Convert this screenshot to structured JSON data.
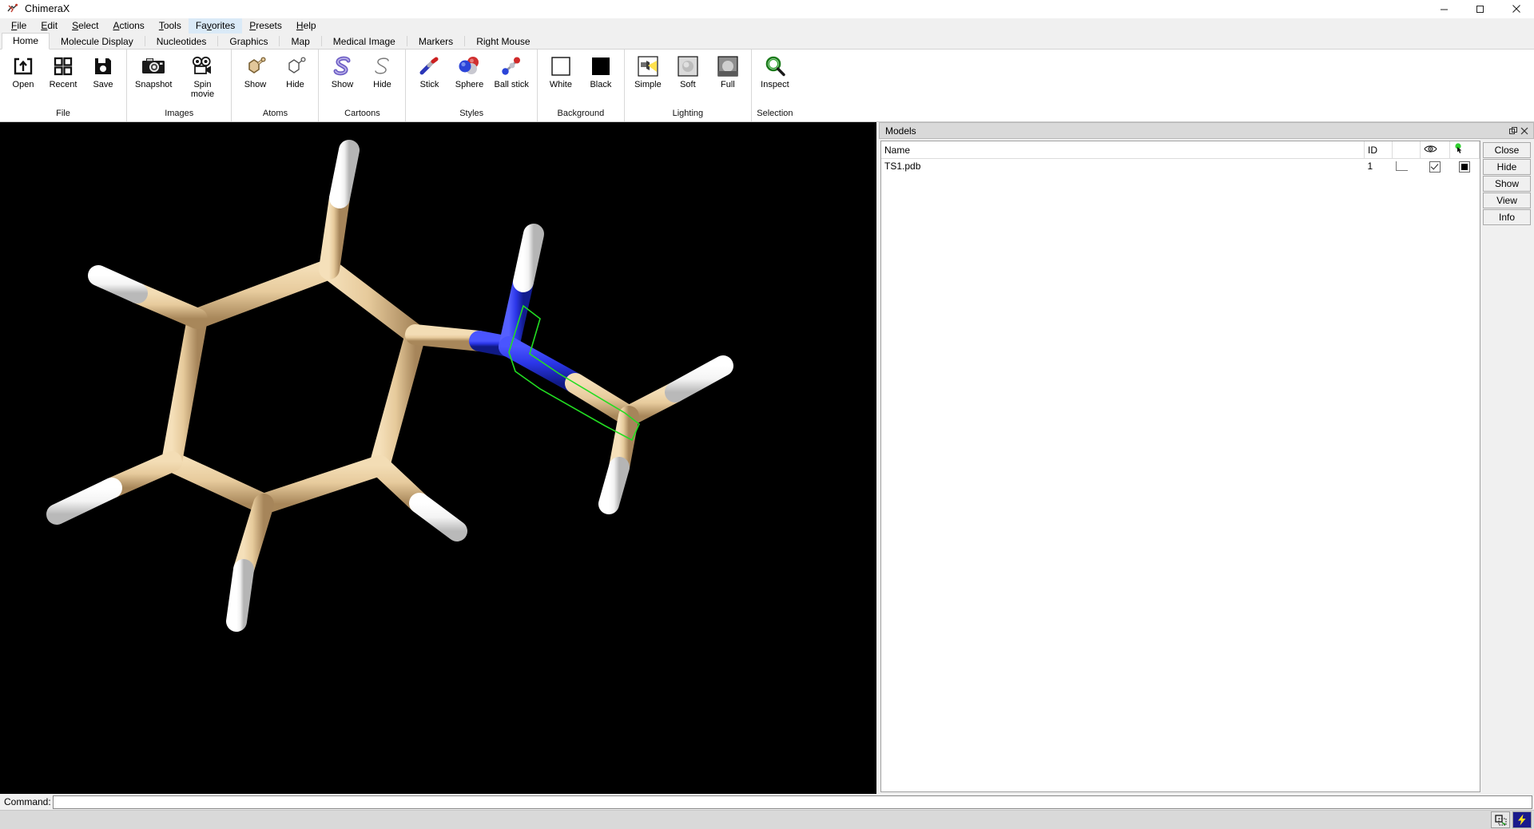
{
  "window": {
    "title": "ChimeraX",
    "app_icon": "chimerax-logo-icon",
    "minimize_glyph": "─",
    "maximize_glyph": "☐",
    "close_glyph": "✕"
  },
  "menubar": {
    "items": [
      {
        "label": "File",
        "mnemonic": "F",
        "active": false
      },
      {
        "label": "Edit",
        "mnemonic": "E",
        "active": false
      },
      {
        "label": "Select",
        "mnemonic": "S",
        "active": false
      },
      {
        "label": "Actions",
        "mnemonic": "A",
        "active": false
      },
      {
        "label": "Tools",
        "mnemonic": "T",
        "active": false
      },
      {
        "label": "Favorites",
        "mnemonic": "v",
        "active": true
      },
      {
        "label": "Presets",
        "mnemonic": "P",
        "active": false
      },
      {
        "label": "Help",
        "mnemonic": "H",
        "active": false
      }
    ]
  },
  "ribbon_tabs": {
    "items": [
      {
        "label": "Home",
        "selected": true
      },
      {
        "label": "Molecule Display",
        "selected": false
      },
      {
        "label": "Nucleotides",
        "selected": false
      },
      {
        "label": "Graphics",
        "selected": false
      },
      {
        "label": "Map",
        "selected": false
      },
      {
        "label": "Medical Image",
        "selected": false
      },
      {
        "label": "Markers",
        "selected": false
      },
      {
        "label": "Right Mouse",
        "selected": false
      }
    ]
  },
  "ribbon": {
    "groups": [
      {
        "label": "File",
        "buttons": [
          {
            "label": "Open",
            "icon": "open-folder-arrow-icon"
          },
          {
            "label": "Recent",
            "icon": "recent-grid-icon"
          },
          {
            "label": "Save",
            "icon": "save-floppy-icon"
          }
        ]
      },
      {
        "label": "Images",
        "buttons": [
          {
            "label": "Snapshot",
            "icon": "camera-icon"
          },
          {
            "label": "Spin movie",
            "icon": "movie-camera-icon"
          }
        ]
      },
      {
        "label": "Atoms",
        "buttons": [
          {
            "label": "Show",
            "icon": "atoms-show-ring-icon"
          },
          {
            "label": "Hide",
            "icon": "atoms-hide-ring-icon"
          }
        ]
      },
      {
        "label": "Cartoons",
        "buttons": [
          {
            "label": "Show",
            "icon": "cartoon-show-ribbon-icon"
          },
          {
            "label": "Hide",
            "icon": "cartoon-hide-ribbon-icon"
          }
        ]
      },
      {
        "label": "Styles",
        "buttons": [
          {
            "label": "Stick",
            "icon": "stick-style-icon"
          },
          {
            "label": "Sphere",
            "icon": "sphere-style-icon"
          },
          {
            "label": "Ball stick",
            "icon": "ball-stick-style-icon"
          }
        ]
      },
      {
        "label": "Background",
        "buttons": [
          {
            "label": "White",
            "icon": "white-swatch-icon"
          },
          {
            "label": "Black",
            "icon": "black-swatch-icon"
          }
        ]
      },
      {
        "label": "Lighting",
        "buttons": [
          {
            "label": "Simple",
            "icon": "lighting-simple-icon"
          },
          {
            "label": "Soft",
            "icon": "lighting-soft-icon"
          },
          {
            "label": "Full",
            "icon": "lighting-full-icon"
          }
        ]
      },
      {
        "label": "Selection",
        "buttons": [
          {
            "label": "Inspect",
            "icon": "magnifier-inspect-icon"
          }
        ]
      }
    ]
  },
  "viewport": {
    "background_color": "#000000",
    "carbon_color": "#e8cfa0",
    "nitrogen_color": "#2b36e0",
    "hydrogen_color": "#ffffff",
    "selection_outline_color": "#22dd22"
  },
  "models_panel": {
    "title": "Models",
    "float_glyph": "❐",
    "close_glyph": "✕",
    "columns": [
      "Name",
      "ID",
      "",
      "eye-icon",
      "select-pointer-icon"
    ],
    "rows": [
      {
        "name": "TS1.pdb",
        "id": "1",
        "shown": true,
        "selected_swatch": true
      }
    ],
    "buttons": [
      {
        "label": "Close"
      },
      {
        "label": "Hide"
      },
      {
        "label": "Show"
      },
      {
        "label": "View"
      },
      {
        "label": "Info"
      }
    ]
  },
  "command_line": {
    "label": "Command:",
    "value": "",
    "placeholder": ""
  },
  "status_bar": {
    "icons": [
      {
        "name": "resize-region-icon"
      },
      {
        "name": "lightning-bolt-icon"
      }
    ]
  }
}
